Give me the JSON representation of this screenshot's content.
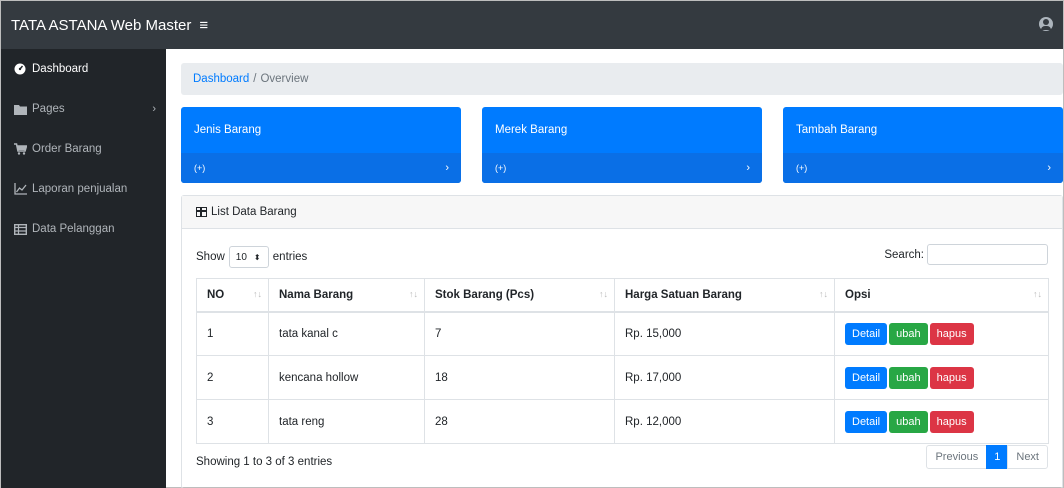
{
  "topbar": {
    "brand": "TATA ASTANA Web Master",
    "menu_icon": "≡",
    "user_icon": "user-circle-icon"
  },
  "sidebar": {
    "items": [
      {
        "label": "Dashboard",
        "icon": "tachometer-icon"
      },
      {
        "label": "Pages",
        "icon": "folder-icon"
      },
      {
        "label": "Order Barang",
        "icon": "cart-icon"
      },
      {
        "label": "Laporan penjualan",
        "icon": "chart-icon"
      },
      {
        "label": "Data Pelanggan",
        "icon": "table-icon"
      }
    ]
  },
  "breadcrumb": {
    "link": "Dashboard",
    "separator": "/",
    "current": "Overview"
  },
  "cards": [
    {
      "title": "Jenis Barang",
      "footer": "(+)"
    },
    {
      "title": "Merek Barang",
      "footer": "(+)"
    },
    {
      "title": "Tambah Barang",
      "footer": "(+)"
    }
  ],
  "panel": {
    "title": "List Data Barang"
  },
  "length": {
    "show": "Show",
    "value": "10",
    "entries": "entries"
  },
  "search": {
    "label": "Search:",
    "value": ""
  },
  "table": {
    "headers": [
      "NO",
      "Nama Barang",
      "Stok Barang (Pcs)",
      "Harga Satuan Barang",
      "Opsi"
    ],
    "rows": [
      {
        "no": "1",
        "nama": "tata kanal c",
        "stok": "7",
        "harga": "Rp. 15,000"
      },
      {
        "no": "2",
        "nama": "kencana hollow",
        "stok": "18",
        "harga": "Rp. 17,000"
      },
      {
        "no": "3",
        "nama": "tata reng",
        "stok": "28",
        "harga": "Rp. 12,000"
      }
    ],
    "actions": {
      "detail": "Detail",
      "ubah": "ubah",
      "hapus": "hapus"
    }
  },
  "info": "Showing 1 to 3 of 3 entries",
  "pagination": {
    "previous": "Previous",
    "current": "1",
    "next": "Next"
  },
  "colors": {
    "primary": "#007bff",
    "success": "#28a745",
    "danger": "#dc3545",
    "dark": "#343a40",
    "sidebar": "#212529"
  }
}
